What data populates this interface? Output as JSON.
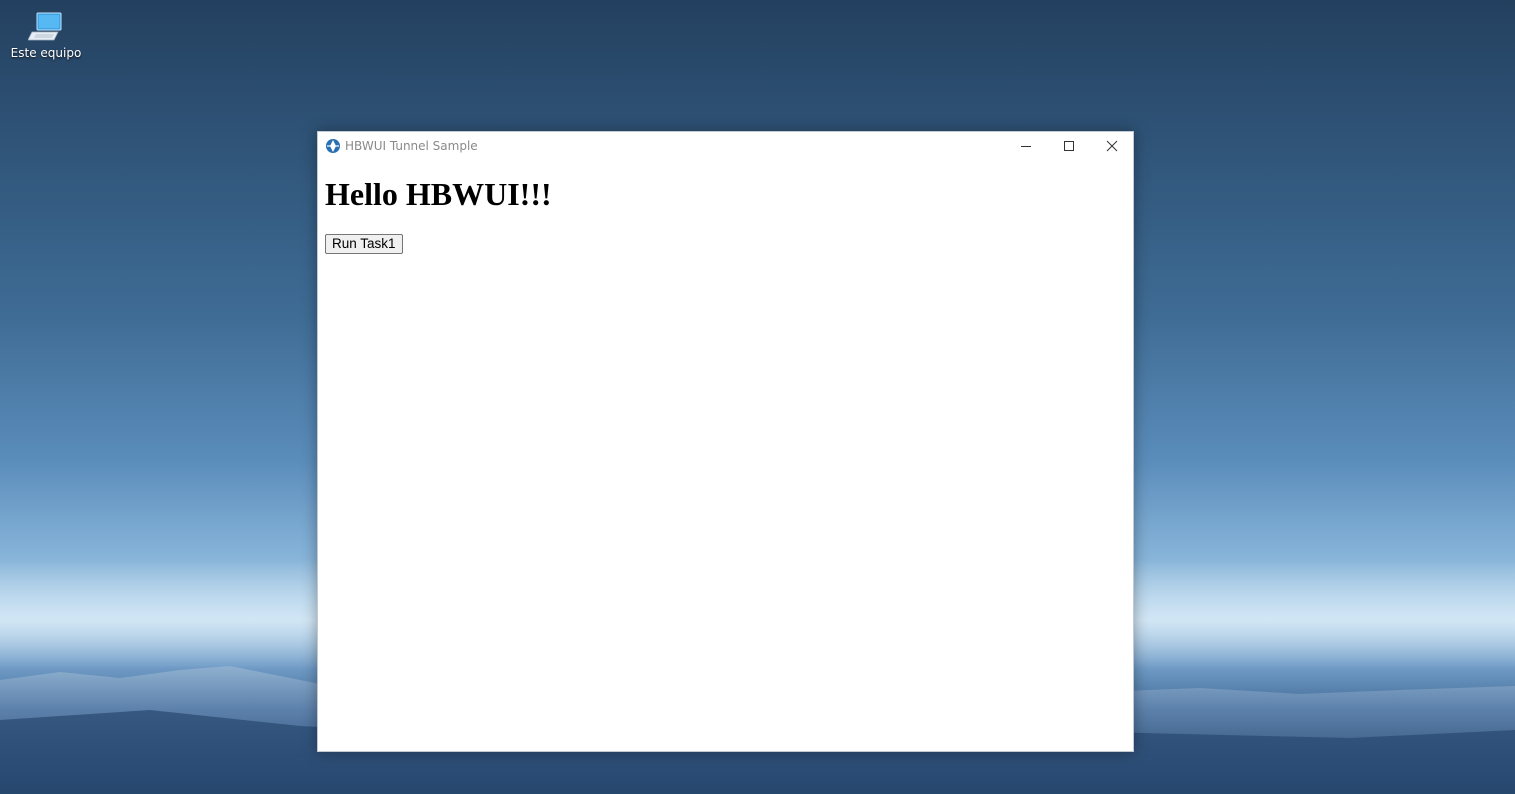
{
  "desktop": {
    "icons": [
      {
        "label": "Este equipo",
        "icon": "computer-icon"
      }
    ]
  },
  "window": {
    "title": "HBWUI Tunnel Sample",
    "app_icon": "app-logo-icon",
    "controls": {
      "minimize": "minimize-icon",
      "maximize": "maximize-icon",
      "close": "close-icon"
    },
    "content": {
      "heading": "Hello HBWUI!!!",
      "button_label": "Run Task1"
    }
  }
}
